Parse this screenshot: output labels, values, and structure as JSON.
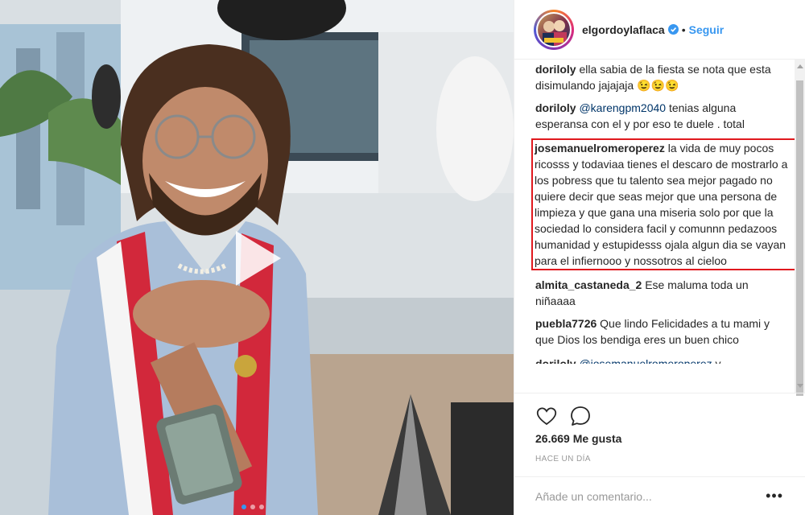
{
  "post": {
    "username": "elgordoylaflaca",
    "separator": "•",
    "follow_label": "Seguir",
    "likes": "26.669 Me gusta",
    "timestamp": "HACE UN DÍA",
    "comment_placeholder": "Añade un comentario...",
    "more_label": "•••"
  },
  "comments": [
    {
      "user": "doriloly",
      "mention": "",
      "text": "ella sabia de la fiesta se nota que esta disimulando jajajaja 😉😉😉"
    },
    {
      "user": "doriloly",
      "mention": "@karengpm2040",
      "text": "tenias alguna esperansa con el y por eso te duele . total"
    },
    {
      "user": "josemanuelromeroperez",
      "mention": "",
      "text": "la vida de muy pocos ricosss y todaviaa tienes el descaro de mostrarlo a los pobress que tu talento sea mejor pagado no quiere decir que seas mejor que una persona de limpieza y que gana una miseria solo por que la sociedad lo considera facil y comunnn pedazoos humanidad y estupidesss ojala algun dia se vayan para el infiernooo y nossotros al cieloo"
    },
    {
      "user": "almita_castaneda_2",
      "mention": "",
      "text": "Ese maluma toda un niñaaaa"
    },
    {
      "user": "puebla7726",
      "mention": "",
      "text": "Que lindo Felicidades a tu mami y que Dios los bendiga eres un buen chico"
    },
    {
      "user": "doriloly",
      "mention": "@josemanuelromeroperez",
      "text": "y"
    }
  ],
  "colors": {
    "accent": "#3897f0",
    "highlight_border": "#e0191e",
    "text": "#262626",
    "muted": "#999999"
  }
}
